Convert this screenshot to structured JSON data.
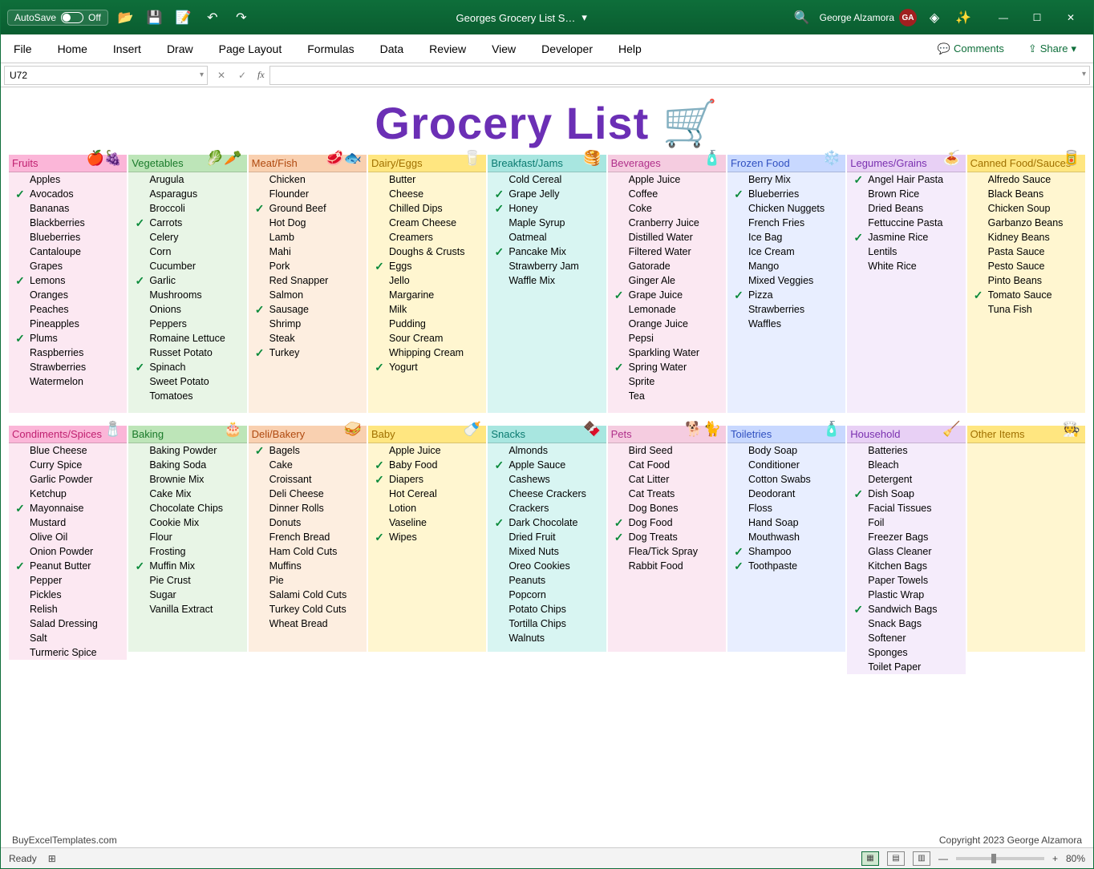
{
  "titlebar": {
    "autosave_label": "AutoSave",
    "autosave_state": "Off",
    "doc_title": "Georges Grocery List S…",
    "user_name": "George Alzamora",
    "user_initials": "GA"
  },
  "ribbon": {
    "tabs": [
      "File",
      "Home",
      "Insert",
      "Draw",
      "Page Layout",
      "Formulas",
      "Data",
      "Review",
      "View",
      "Developer",
      "Help"
    ],
    "comments": "Comments",
    "share": "Share"
  },
  "formula_bar": {
    "cell_ref": "U72",
    "fx": "fx"
  },
  "document": {
    "title": "Grocery List",
    "title_emoji": "🛒",
    "credit_left": "BuyExcelTemplates.com",
    "credit_right": "Copyright 2023 George Alzamora"
  },
  "status": {
    "ready": "Ready",
    "zoom": "80%"
  },
  "categories": [
    [
      {
        "cls": "c-fruits",
        "name": "Fruits",
        "emoji": "🍎🍇",
        "items": [
          [
            "",
            "Apples"
          ],
          [
            "✓",
            "Avocados"
          ],
          [
            "",
            "Bananas"
          ],
          [
            "",
            "Blackberries"
          ],
          [
            "",
            "Blueberries"
          ],
          [
            "",
            "Cantaloupe"
          ],
          [
            "",
            "Grapes"
          ],
          [
            "✓",
            "Lemons"
          ],
          [
            "",
            "Oranges"
          ],
          [
            "",
            "Peaches"
          ],
          [
            "",
            "Pineapples"
          ],
          [
            "✓",
            "Plums"
          ],
          [
            "",
            "Raspberries"
          ],
          [
            "",
            "Strawberries"
          ],
          [
            "",
            "Watermelon"
          ]
        ]
      },
      {
        "cls": "c-veg",
        "name": "Vegetables",
        "emoji": "🥬🥕",
        "items": [
          [
            "",
            "Arugula"
          ],
          [
            "",
            "Asparagus"
          ],
          [
            "",
            "Broccoli"
          ],
          [
            "✓",
            "Carrots"
          ],
          [
            "",
            "Celery"
          ],
          [
            "",
            "Corn"
          ],
          [
            "",
            "Cucumber"
          ],
          [
            "✓",
            "Garlic"
          ],
          [
            "",
            "Mushrooms"
          ],
          [
            "",
            "Onions"
          ],
          [
            "",
            "Peppers"
          ],
          [
            "",
            "Romaine Lettuce"
          ],
          [
            "",
            "Russet Potato"
          ],
          [
            "✓",
            "Spinach"
          ],
          [
            "",
            "Sweet Potato"
          ],
          [
            "",
            "Tomatoes"
          ]
        ]
      },
      {
        "cls": "c-meat",
        "name": "Meat/Fish",
        "emoji": "🥩🐟",
        "items": [
          [
            "",
            "Chicken"
          ],
          [
            "",
            "Flounder"
          ],
          [
            "✓",
            "Ground Beef"
          ],
          [
            "",
            "Hot Dog"
          ],
          [
            "",
            "Lamb"
          ],
          [
            "",
            "Mahi"
          ],
          [
            "",
            "Pork"
          ],
          [
            "",
            "Red Snapper"
          ],
          [
            "",
            "Salmon"
          ],
          [
            "✓",
            "Sausage"
          ],
          [
            "",
            "Shrimp"
          ],
          [
            "",
            "Steak"
          ],
          [
            "✓",
            "Turkey"
          ]
        ]
      },
      {
        "cls": "c-dairy",
        "name": "Dairy/Eggs",
        "emoji": "🥛",
        "items": [
          [
            "",
            "Butter"
          ],
          [
            "",
            "Cheese"
          ],
          [
            "",
            "Chilled Dips"
          ],
          [
            "",
            "Cream Cheese"
          ],
          [
            "",
            "Creamers"
          ],
          [
            "",
            "Doughs & Crusts"
          ],
          [
            "✓",
            "Eggs"
          ],
          [
            "",
            "Jello"
          ],
          [
            "",
            "Margarine"
          ],
          [
            "",
            "Milk"
          ],
          [
            "",
            "Pudding"
          ],
          [
            "",
            "Sour Cream"
          ],
          [
            "",
            "Whipping Cream"
          ],
          [
            "✓",
            "Yogurt"
          ]
        ]
      },
      {
        "cls": "c-break",
        "name": "Breakfast/Jams",
        "emoji": "🥞",
        "items": [
          [
            "",
            "Cold Cereal"
          ],
          [
            "✓",
            "Grape Jelly"
          ],
          [
            "✓",
            "Honey"
          ],
          [
            "",
            "Maple Syrup"
          ],
          [
            "",
            "Oatmeal"
          ],
          [
            "✓",
            "Pancake Mix"
          ],
          [
            "",
            "Strawberry Jam"
          ],
          [
            "",
            "Waffle Mix"
          ]
        ]
      },
      {
        "cls": "c-bev",
        "name": "Beverages",
        "emoji": "🧴",
        "items": [
          [
            "",
            "Apple Juice"
          ],
          [
            "",
            "Coffee"
          ],
          [
            "",
            "Coke"
          ],
          [
            "",
            "Cranberry Juice"
          ],
          [
            "",
            "Distilled Water"
          ],
          [
            "",
            "Filtered Water"
          ],
          [
            "",
            "Gatorade"
          ],
          [
            "",
            "Ginger Ale"
          ],
          [
            "✓",
            "Grape Juice"
          ],
          [
            "",
            "Lemonade"
          ],
          [
            "",
            "Orange Juice"
          ],
          [
            "",
            "Pepsi"
          ],
          [
            "",
            "Sparkling Water"
          ],
          [
            "✓",
            "Spring Water"
          ],
          [
            "",
            "Sprite"
          ],
          [
            "",
            "Tea"
          ]
        ]
      },
      {
        "cls": "c-frozen",
        "name": "Frozen Food",
        "emoji": "❄️",
        "items": [
          [
            "",
            "Berry Mix"
          ],
          [
            "✓",
            "Blueberries"
          ],
          [
            "",
            "Chicken Nuggets"
          ],
          [
            "",
            "French Fries"
          ],
          [
            "",
            "Ice Bag"
          ],
          [
            "",
            "Ice Cream"
          ],
          [
            "",
            "Mango"
          ],
          [
            "",
            "Mixed Veggies"
          ],
          [
            "✓",
            "Pizza"
          ],
          [
            "",
            "Strawberries"
          ],
          [
            "",
            "Waffles"
          ]
        ]
      },
      {
        "cls": "c-leg",
        "name": "Legumes/Grains",
        "emoji": "🍝",
        "items": [
          [
            "✓",
            "Angel Hair Pasta"
          ],
          [
            "",
            "Brown Rice"
          ],
          [
            "",
            "Dried Beans"
          ],
          [
            "",
            "Fettuccine Pasta"
          ],
          [
            "✓",
            "Jasmine Rice"
          ],
          [
            "",
            "Lentils"
          ],
          [
            "",
            "White Rice"
          ]
        ]
      },
      {
        "cls": "c-can",
        "name": "Canned Food/Sauces",
        "emoji": "🥫",
        "items": [
          [
            "",
            "Alfredo Sauce"
          ],
          [
            "",
            "Black Beans"
          ],
          [
            "",
            "Chicken Soup"
          ],
          [
            "",
            "Garbanzo Beans"
          ],
          [
            "",
            "Kidney Beans"
          ],
          [
            "",
            "Pasta Sauce"
          ],
          [
            "",
            "Pesto Sauce"
          ],
          [
            "",
            "Pinto Beans"
          ],
          [
            "✓",
            "Tomato Sauce"
          ],
          [
            "",
            "Tuna Fish"
          ]
        ]
      }
    ],
    [
      {
        "cls": "c-cond",
        "name": "Condiments/Spices",
        "emoji": "🧂",
        "items": [
          [
            "",
            "Blue Cheese"
          ],
          [
            "",
            "Curry Spice"
          ],
          [
            "",
            "Garlic Powder"
          ],
          [
            "",
            "Ketchup"
          ],
          [
            "✓",
            "Mayonnaise"
          ],
          [
            "",
            "Mustard"
          ],
          [
            "",
            "Olive Oil"
          ],
          [
            "",
            "Onion Powder"
          ],
          [
            "✓",
            "Peanut Butter"
          ],
          [
            "",
            "Pepper"
          ],
          [
            "",
            "Pickles"
          ],
          [
            "",
            "Relish"
          ],
          [
            "",
            "Salad Dressing"
          ],
          [
            "",
            "Salt"
          ],
          [
            "",
            "Turmeric Spice"
          ]
        ]
      },
      {
        "cls": "c-bake",
        "name": "Baking",
        "emoji": "🎂",
        "items": [
          [
            "",
            "Baking Powder"
          ],
          [
            "",
            "Baking Soda"
          ],
          [
            "",
            "Brownie Mix"
          ],
          [
            "",
            "Cake Mix"
          ],
          [
            "",
            "Chocolate Chips"
          ],
          [
            "",
            "Cookie Mix"
          ],
          [
            "",
            "Flour"
          ],
          [
            "",
            "Frosting"
          ],
          [
            "✓",
            "Muffin Mix"
          ],
          [
            "",
            "Pie Crust"
          ],
          [
            "",
            "Sugar"
          ],
          [
            "",
            "Vanilla Extract"
          ]
        ]
      },
      {
        "cls": "c-deli",
        "name": "Deli/Bakery",
        "emoji": "🥪",
        "items": [
          [
            "✓",
            "Bagels"
          ],
          [
            "",
            "Cake"
          ],
          [
            "",
            "Croissant"
          ],
          [
            "",
            "Deli Cheese"
          ],
          [
            "",
            "Dinner Rolls"
          ],
          [
            "",
            "Donuts"
          ],
          [
            "",
            "French Bread"
          ],
          [
            "",
            "Ham Cold Cuts"
          ],
          [
            "",
            "Muffins"
          ],
          [
            "",
            "Pie"
          ],
          [
            "",
            "Salami Cold Cuts"
          ],
          [
            "",
            "Turkey Cold Cuts"
          ],
          [
            "",
            "Wheat Bread"
          ]
        ]
      },
      {
        "cls": "c-baby",
        "name": "Baby",
        "emoji": "🍼",
        "items": [
          [
            "",
            "Apple Juice"
          ],
          [
            "✓",
            "Baby Food"
          ],
          [
            "✓",
            "Diapers"
          ],
          [
            "",
            "Hot Cereal"
          ],
          [
            "",
            "Lotion"
          ],
          [
            "",
            "Vaseline"
          ],
          [
            "✓",
            "Wipes"
          ]
        ]
      },
      {
        "cls": "c-snack",
        "name": "Snacks",
        "emoji": "🍫",
        "items": [
          [
            "",
            "Almonds"
          ],
          [
            "✓",
            "Apple Sauce"
          ],
          [
            "",
            "Cashews"
          ],
          [
            "",
            "Cheese Crackers"
          ],
          [
            "",
            "Crackers"
          ],
          [
            "✓",
            "Dark Chocolate"
          ],
          [
            "",
            "Dried Fruit"
          ],
          [
            "",
            "Mixed Nuts"
          ],
          [
            "",
            "Oreo Cookies"
          ],
          [
            "",
            "Peanuts"
          ],
          [
            "",
            "Popcorn"
          ],
          [
            "",
            "Potato Chips"
          ],
          [
            "",
            "Tortilla Chips"
          ],
          [
            "",
            "Walnuts"
          ]
        ]
      },
      {
        "cls": "c-pets",
        "name": "Pets",
        "emoji": "🐕🐈",
        "items": [
          [
            "",
            "Bird Seed"
          ],
          [
            "",
            "Cat Food"
          ],
          [
            "",
            "Cat Litter"
          ],
          [
            "",
            "Cat Treats"
          ],
          [
            "",
            "Dog Bones"
          ],
          [
            "✓",
            "Dog Food"
          ],
          [
            "✓",
            "Dog Treats"
          ],
          [
            "",
            "Flea/Tick Spray"
          ],
          [
            "",
            "Rabbit Food"
          ]
        ]
      },
      {
        "cls": "c-toil",
        "name": "Toiletries",
        "emoji": "🧴",
        "items": [
          [
            "",
            "Body Soap"
          ],
          [
            "",
            "Conditioner"
          ],
          [
            "",
            "Cotton Swabs"
          ],
          [
            "",
            "Deodorant"
          ],
          [
            "",
            "Floss"
          ],
          [
            "",
            "Hand Soap"
          ],
          [
            "",
            "Mouthwash"
          ],
          [
            "✓",
            "Shampoo"
          ],
          [
            "✓",
            "Toothpaste"
          ]
        ]
      },
      {
        "cls": "c-house",
        "name": "Household",
        "emoji": "🧹",
        "items": [
          [
            "",
            "Batteries"
          ],
          [
            "",
            "Bleach"
          ],
          [
            "",
            "Detergent"
          ],
          [
            "✓",
            "Dish Soap"
          ],
          [
            "",
            "Facial Tissues"
          ],
          [
            "",
            "Foil"
          ],
          [
            "",
            "Freezer Bags"
          ],
          [
            "",
            "Glass Cleaner"
          ],
          [
            "",
            "Kitchen Bags"
          ],
          [
            "",
            "Paper Towels"
          ],
          [
            "",
            "Plastic Wrap"
          ],
          [
            "✓",
            "Sandwich Bags"
          ],
          [
            "",
            "Snack Bags"
          ],
          [
            "",
            "Softener"
          ],
          [
            "",
            "Sponges"
          ],
          [
            "",
            "Toilet Paper"
          ]
        ]
      },
      {
        "cls": "c-other",
        "name": "Other Items",
        "emoji": "🧑‍🍳",
        "items": []
      }
    ]
  ]
}
